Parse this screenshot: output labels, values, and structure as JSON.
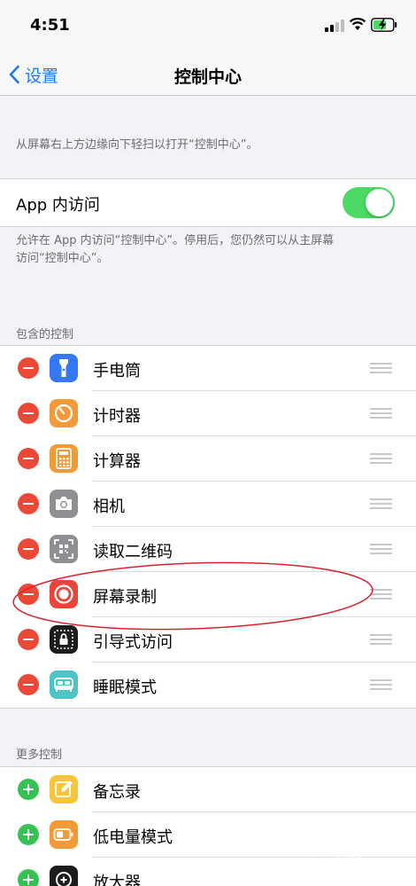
{
  "status_bar": {
    "time": "4:51"
  },
  "nav": {
    "back_label": "设置",
    "title": "控制中心"
  },
  "hints": {
    "swipe": "从屏幕右上方边缘向下轻扫以打开“控制中心”。",
    "access_line1": "允许在 App 内访问“控制中心”。停用后，您仍然可以从主屏幕",
    "access_line2": "访问“控制中心”。"
  },
  "access_in_apps": {
    "label": "App 内访问",
    "enabled": true
  },
  "included": {
    "header": "包含的控制",
    "items": [
      {
        "label": "手电筒",
        "icon": "flashlight-icon",
        "color": "#3478f6"
      },
      {
        "label": "计时器",
        "icon": "timer-icon",
        "color": "#f29a38"
      },
      {
        "label": "计算器",
        "icon": "calculator-icon",
        "color": "#f29a38"
      },
      {
        "label": "相机",
        "icon": "camera-icon",
        "color": "#8e8e93"
      },
      {
        "label": "读取二维码",
        "icon": "qr-code-icon",
        "color": "#8e8e93"
      },
      {
        "label": "屏幕录制",
        "icon": "screen-record-icon",
        "color": "#e9453a"
      },
      {
        "label": "引导式访问",
        "icon": "guided-access-icon",
        "color": "#1c1c1e"
      },
      {
        "label": "睡眠模式",
        "icon": "bed-icon",
        "color": "#4fc3c6"
      }
    ]
  },
  "more": {
    "header": "更多控制",
    "items": [
      {
        "label": "备忘录",
        "icon": "notes-icon",
        "color": "#f7c53b"
      },
      {
        "label": "低电量模式",
        "icon": "low-power-icon",
        "color": "#f29a38"
      },
      {
        "label": "放大器",
        "icon": "magnifier-icon",
        "color": "#1c1c1e"
      }
    ]
  },
  "watermark": {
    "text": "经验"
  },
  "colors": {
    "accent": "#1a7cf5",
    "toggle_on": "#4cd964",
    "remove": "#ec4837",
    "add": "#36c253",
    "annotation": "#d9232e"
  }
}
